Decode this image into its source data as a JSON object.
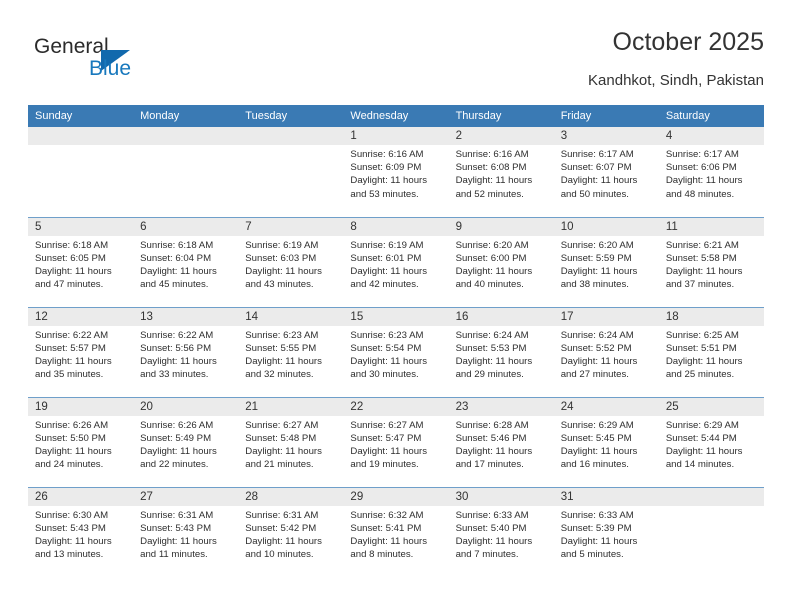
{
  "brand": {
    "name_top": "General",
    "name_bottom": "Blue",
    "accent_color": "#1169ad",
    "text_color": "#2b2b2b"
  },
  "header": {
    "title": "October 2025",
    "location": "Kandhkot, Sindh, Pakistan"
  },
  "theme": {
    "header_row_bg": "#3a7ab4",
    "header_row_text": "#ffffff",
    "daynum_bg": "#ebebeb",
    "row_divider": "#6f9fca",
    "body_text": "#2e2e2e"
  },
  "weekday_headers": [
    "Sunday",
    "Monday",
    "Tuesday",
    "Wednesday",
    "Thursday",
    "Friday",
    "Saturday"
  ],
  "weeks": [
    [
      {
        "day": "",
        "sunrise": "",
        "sunset": "",
        "daylight1": "",
        "daylight2": ""
      },
      {
        "day": "",
        "sunrise": "",
        "sunset": "",
        "daylight1": "",
        "daylight2": ""
      },
      {
        "day": "",
        "sunrise": "",
        "sunset": "",
        "daylight1": "",
        "daylight2": ""
      },
      {
        "day": "1",
        "sunrise": "Sunrise: 6:16 AM",
        "sunset": "Sunset: 6:09 PM",
        "daylight1": "Daylight: 11 hours",
        "daylight2": "and 53 minutes."
      },
      {
        "day": "2",
        "sunrise": "Sunrise: 6:16 AM",
        "sunset": "Sunset: 6:08 PM",
        "daylight1": "Daylight: 11 hours",
        "daylight2": "and 52 minutes."
      },
      {
        "day": "3",
        "sunrise": "Sunrise: 6:17 AM",
        "sunset": "Sunset: 6:07 PM",
        "daylight1": "Daylight: 11 hours",
        "daylight2": "and 50 minutes."
      },
      {
        "day": "4",
        "sunrise": "Sunrise: 6:17 AM",
        "sunset": "Sunset: 6:06 PM",
        "daylight1": "Daylight: 11 hours",
        "daylight2": "and 48 minutes."
      }
    ],
    [
      {
        "day": "5",
        "sunrise": "Sunrise: 6:18 AM",
        "sunset": "Sunset: 6:05 PM",
        "daylight1": "Daylight: 11 hours",
        "daylight2": "and 47 minutes."
      },
      {
        "day": "6",
        "sunrise": "Sunrise: 6:18 AM",
        "sunset": "Sunset: 6:04 PM",
        "daylight1": "Daylight: 11 hours",
        "daylight2": "and 45 minutes."
      },
      {
        "day": "7",
        "sunrise": "Sunrise: 6:19 AM",
        "sunset": "Sunset: 6:03 PM",
        "daylight1": "Daylight: 11 hours",
        "daylight2": "and 43 minutes."
      },
      {
        "day": "8",
        "sunrise": "Sunrise: 6:19 AM",
        "sunset": "Sunset: 6:01 PM",
        "daylight1": "Daylight: 11 hours",
        "daylight2": "and 42 minutes."
      },
      {
        "day": "9",
        "sunrise": "Sunrise: 6:20 AM",
        "sunset": "Sunset: 6:00 PM",
        "daylight1": "Daylight: 11 hours",
        "daylight2": "and 40 minutes."
      },
      {
        "day": "10",
        "sunrise": "Sunrise: 6:20 AM",
        "sunset": "Sunset: 5:59 PM",
        "daylight1": "Daylight: 11 hours",
        "daylight2": "and 38 minutes."
      },
      {
        "day": "11",
        "sunrise": "Sunrise: 6:21 AM",
        "sunset": "Sunset: 5:58 PM",
        "daylight1": "Daylight: 11 hours",
        "daylight2": "and 37 minutes."
      }
    ],
    [
      {
        "day": "12",
        "sunrise": "Sunrise: 6:22 AM",
        "sunset": "Sunset: 5:57 PM",
        "daylight1": "Daylight: 11 hours",
        "daylight2": "and 35 minutes."
      },
      {
        "day": "13",
        "sunrise": "Sunrise: 6:22 AM",
        "sunset": "Sunset: 5:56 PM",
        "daylight1": "Daylight: 11 hours",
        "daylight2": "and 33 minutes."
      },
      {
        "day": "14",
        "sunrise": "Sunrise: 6:23 AM",
        "sunset": "Sunset: 5:55 PM",
        "daylight1": "Daylight: 11 hours",
        "daylight2": "and 32 minutes."
      },
      {
        "day": "15",
        "sunrise": "Sunrise: 6:23 AM",
        "sunset": "Sunset: 5:54 PM",
        "daylight1": "Daylight: 11 hours",
        "daylight2": "and 30 minutes."
      },
      {
        "day": "16",
        "sunrise": "Sunrise: 6:24 AM",
        "sunset": "Sunset: 5:53 PM",
        "daylight1": "Daylight: 11 hours",
        "daylight2": "and 29 minutes."
      },
      {
        "day": "17",
        "sunrise": "Sunrise: 6:24 AM",
        "sunset": "Sunset: 5:52 PM",
        "daylight1": "Daylight: 11 hours",
        "daylight2": "and 27 minutes."
      },
      {
        "day": "18",
        "sunrise": "Sunrise: 6:25 AM",
        "sunset": "Sunset: 5:51 PM",
        "daylight1": "Daylight: 11 hours",
        "daylight2": "and 25 minutes."
      }
    ],
    [
      {
        "day": "19",
        "sunrise": "Sunrise: 6:26 AM",
        "sunset": "Sunset: 5:50 PM",
        "daylight1": "Daylight: 11 hours",
        "daylight2": "and 24 minutes."
      },
      {
        "day": "20",
        "sunrise": "Sunrise: 6:26 AM",
        "sunset": "Sunset: 5:49 PM",
        "daylight1": "Daylight: 11 hours",
        "daylight2": "and 22 minutes."
      },
      {
        "day": "21",
        "sunrise": "Sunrise: 6:27 AM",
        "sunset": "Sunset: 5:48 PM",
        "daylight1": "Daylight: 11 hours",
        "daylight2": "and 21 minutes."
      },
      {
        "day": "22",
        "sunrise": "Sunrise: 6:27 AM",
        "sunset": "Sunset: 5:47 PM",
        "daylight1": "Daylight: 11 hours",
        "daylight2": "and 19 minutes."
      },
      {
        "day": "23",
        "sunrise": "Sunrise: 6:28 AM",
        "sunset": "Sunset: 5:46 PM",
        "daylight1": "Daylight: 11 hours",
        "daylight2": "and 17 minutes."
      },
      {
        "day": "24",
        "sunrise": "Sunrise: 6:29 AM",
        "sunset": "Sunset: 5:45 PM",
        "daylight1": "Daylight: 11 hours",
        "daylight2": "and 16 minutes."
      },
      {
        "day": "25",
        "sunrise": "Sunrise: 6:29 AM",
        "sunset": "Sunset: 5:44 PM",
        "daylight1": "Daylight: 11 hours",
        "daylight2": "and 14 minutes."
      }
    ],
    [
      {
        "day": "26",
        "sunrise": "Sunrise: 6:30 AM",
        "sunset": "Sunset: 5:43 PM",
        "daylight1": "Daylight: 11 hours",
        "daylight2": "and 13 minutes."
      },
      {
        "day": "27",
        "sunrise": "Sunrise: 6:31 AM",
        "sunset": "Sunset: 5:43 PM",
        "daylight1": "Daylight: 11 hours",
        "daylight2": "and 11 minutes."
      },
      {
        "day": "28",
        "sunrise": "Sunrise: 6:31 AM",
        "sunset": "Sunset: 5:42 PM",
        "daylight1": "Daylight: 11 hours",
        "daylight2": "and 10 minutes."
      },
      {
        "day": "29",
        "sunrise": "Sunrise: 6:32 AM",
        "sunset": "Sunset: 5:41 PM",
        "daylight1": "Daylight: 11 hours",
        "daylight2": "and 8 minutes."
      },
      {
        "day": "30",
        "sunrise": "Sunrise: 6:33 AM",
        "sunset": "Sunset: 5:40 PM",
        "daylight1": "Daylight: 11 hours",
        "daylight2": "and 7 minutes."
      },
      {
        "day": "31",
        "sunrise": "Sunrise: 6:33 AM",
        "sunset": "Sunset: 5:39 PM",
        "daylight1": "Daylight: 11 hours",
        "daylight2": "and 5 minutes."
      },
      {
        "day": "",
        "sunrise": "",
        "sunset": "",
        "daylight1": "",
        "daylight2": ""
      }
    ]
  ]
}
